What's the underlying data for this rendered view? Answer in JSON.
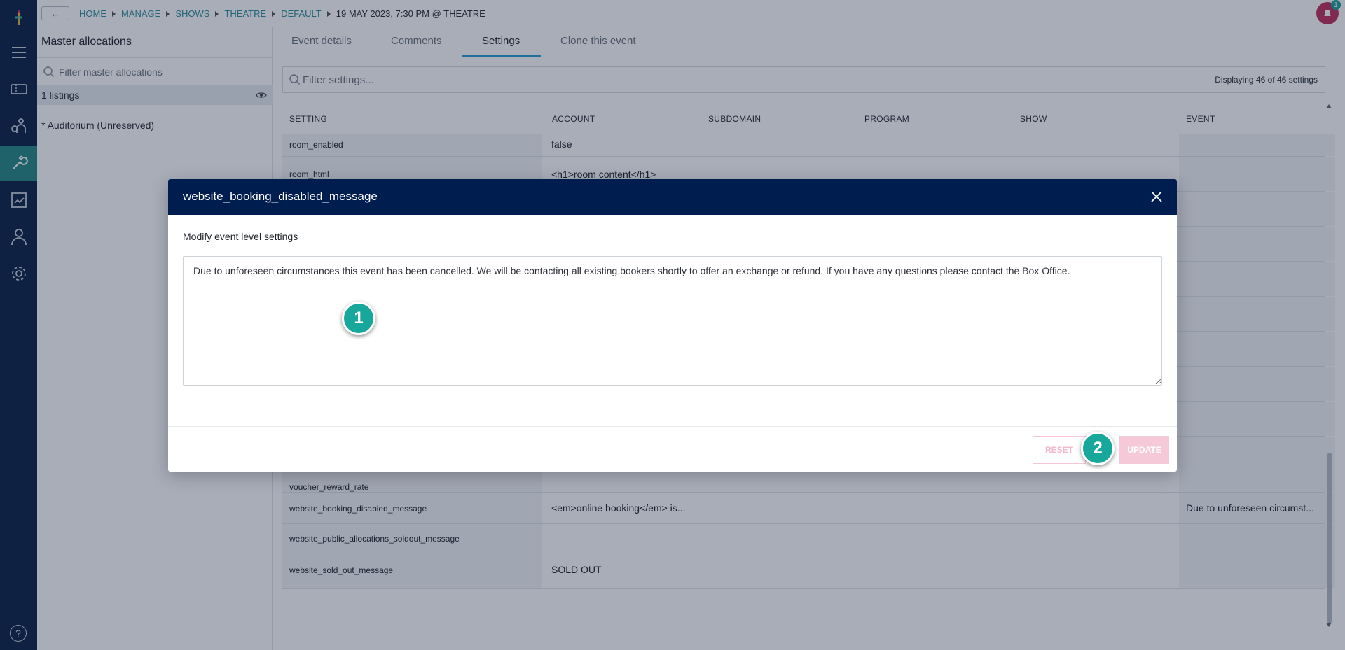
{
  "nav": {
    "back_label": "←",
    "breadcrumbs": [
      "HOME",
      "MANAGE",
      "SHOWS",
      "THEATRE",
      "DEFAULT",
      "19 MAY 2023, 7:30 PM @ THEATRE"
    ],
    "notification_count": "1",
    "help_label": "?"
  },
  "sidebar_icons": [
    "logo-icon",
    "menu-icon",
    "ticket-icon",
    "audience-icon",
    "wrench-icon",
    "report-icon",
    "person-icon",
    "gear-icon",
    "help-icon"
  ],
  "panel": {
    "title": "Master allocations",
    "filter_placeholder": "Filter master allocations",
    "listings_label": "1 listings",
    "allocation_item": "* Auditorium (Unreserved)"
  },
  "tabs": [
    "Event details",
    "Comments",
    "Settings",
    "Clone this event"
  ],
  "active_tab": "Settings",
  "settings": {
    "filter_placeholder": "Filter settings...",
    "display_count": "Displaying 46 of 46 settings",
    "columns": [
      "SETTING",
      "ACCOUNT",
      "SUBDOMAIN",
      "PROGRAM",
      "SHOW",
      "EVENT"
    ],
    "rows": [
      {
        "setting": "room_enabled",
        "account": "false",
        "event": ""
      },
      {
        "setting": "room_html",
        "account": "<h1>room content</h1>",
        "event": ""
      },
      {
        "setting": "voucher_reward_rate",
        "account": "",
        "event": ""
      },
      {
        "setting": "website_booking_disabled_message",
        "account": "<em>online booking</em> is...",
        "event": "Due to unforeseen circumst..."
      },
      {
        "setting": "website_public_allocations_soldout_message",
        "account": "",
        "event": ""
      },
      {
        "setting": "website_sold_out_message",
        "account": "SOLD OUT",
        "event": ""
      }
    ]
  },
  "modal": {
    "title": "website_booking_disabled_message",
    "subtitle": "Modify event level settings",
    "value": "Due to unforeseen circumstances this event has been cancelled. We will be contacting all existing bookers shortly to offer an exchange or refund. If you have any questions please contact the Box Office.",
    "reset_label": "RESET",
    "update_label": "UPDATE"
  },
  "markers": [
    "1",
    "2"
  ],
  "colors": {
    "rail": "#0f2547",
    "rail_active": "#2a8a86",
    "modal_header": "#001d4f",
    "accent_link": "#2f8f9d",
    "marker": "#17a79b",
    "update_button": "#f6c9d8"
  }
}
